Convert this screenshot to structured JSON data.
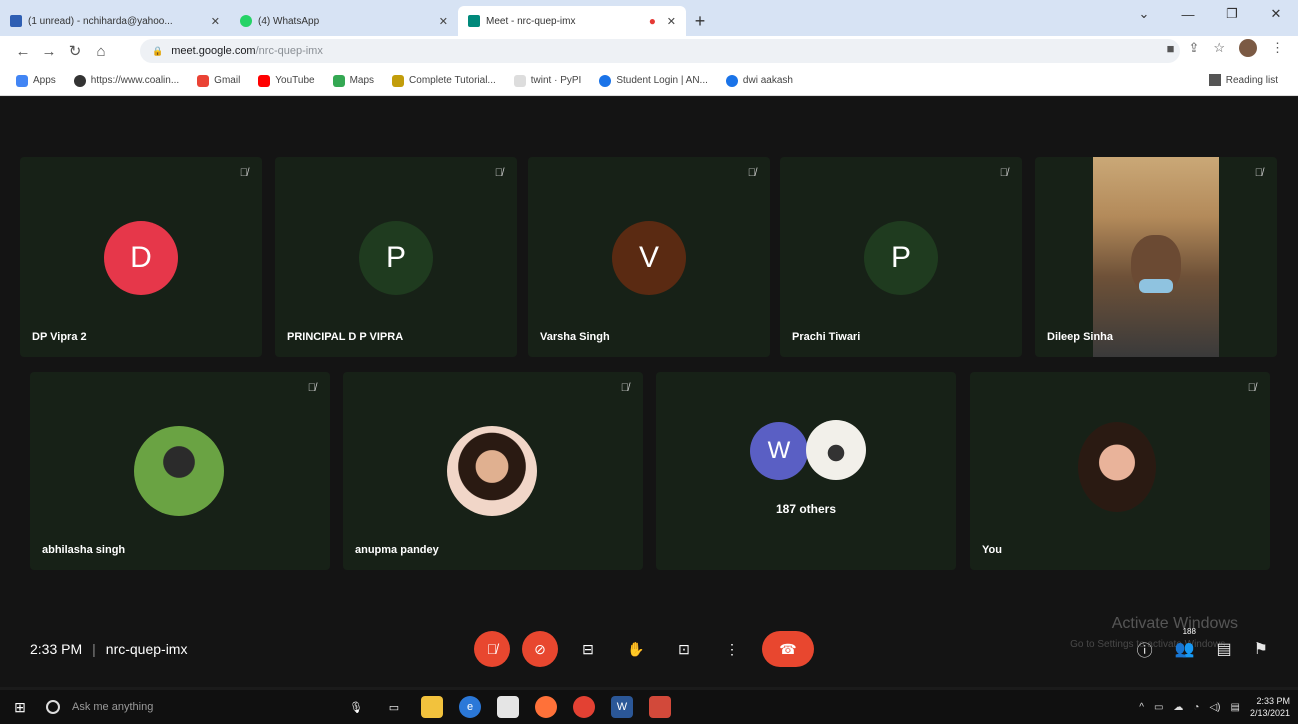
{
  "browser": {
    "tabs": [
      {
        "title": "(1 unread) - nchiharda@yahoo...",
        "icon": "mail-icon",
        "color": "#2f5fb3"
      },
      {
        "title": "(4) WhatsApp",
        "icon": "whatsapp-icon",
        "color": "#25d366"
      },
      {
        "title": "Meet - nrc-quep-imx",
        "icon": "meet-icon",
        "color": "#00897b"
      }
    ],
    "new_tab": "+",
    "url_host": "meet.google.com",
    "url_path": "/nrc-quep-imx",
    "bookmarks": [
      {
        "label": "Apps",
        "icon": "apps-icon",
        "color": "#4285f4"
      },
      {
        "label": "https://www.coalin...",
        "icon": "globe-icon",
        "color": "#333333"
      },
      {
        "label": "Gmail",
        "icon": "gmail-icon",
        "color": "#ea4335"
      },
      {
        "label": "YouTube",
        "icon": "youtube-icon",
        "color": "#ff0000"
      },
      {
        "label": "Maps",
        "icon": "maps-icon",
        "color": "#34a853"
      },
      {
        "label": "Complete Tutorial...",
        "icon": "bookmark-icon",
        "color": "#c29d0b"
      },
      {
        "label": "twint · PyPI",
        "icon": "pypi-icon",
        "color": "#8a8a8a"
      },
      {
        "label": "Student Login | AN...",
        "icon": "student-icon",
        "color": "#1a73e8"
      },
      {
        "label": "dwi aakash",
        "icon": "person-icon",
        "color": "#1a73e8"
      }
    ],
    "reading_list": "Reading list"
  },
  "meet": {
    "participants_row1": [
      {
        "name": "DP Vipra 2",
        "initial": "D",
        "avatar_color": "#e6374a"
      },
      {
        "name": "PRINCIPAL D P VIPRA",
        "initial": "P",
        "avatar_color": "#1f3b1f"
      },
      {
        "name": "Varsha Singh",
        "initial": "V",
        "avatar_color": "#5a2a12"
      },
      {
        "name": "Prachi Tiwari",
        "initial": "P",
        "avatar_color": "#1f3b1f"
      },
      {
        "name": "Dileep Sinha",
        "initial": "",
        "avatar_color": ""
      }
    ],
    "participants_row2": [
      {
        "name": "abhilasha singh"
      },
      {
        "name": "anupma pandey"
      },
      {
        "name": "",
        "initial": "W",
        "others_label": "187 others"
      },
      {
        "name": "You"
      }
    ],
    "time": "2:33 PM",
    "meeting_code": "nrc-quep-imx",
    "participant_count": "188",
    "watermark_title": "Activate Windows",
    "watermark_sub": "Go to Settings to activate Windows."
  },
  "taskbar": {
    "search_placeholder": "Ask me anything",
    "clock_time": "2:33 PM",
    "clock_date": "2/13/2021"
  }
}
